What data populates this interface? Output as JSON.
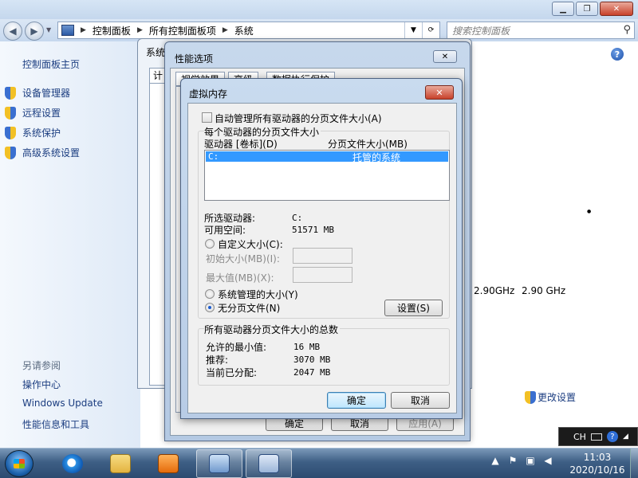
{
  "control_panel": {
    "breadcrumb": [
      "控制面板",
      "所有控制面板项",
      "系统"
    ],
    "search_placeholder": "搜索控制面板",
    "sidebar": {
      "home": "控制面板主页",
      "items": [
        "设备管理器",
        "远程设置",
        "系统保护",
        "高级系统设置"
      ],
      "see_also_title": "另请参阅",
      "see_also": [
        "操作中心",
        "Windows Update",
        "性能信息和工具"
      ]
    },
    "main": {
      "cpu_freq_1": "2.90GHz",
      "cpu_freq_2": "2.90 GHz",
      "change_settings": "更改设置"
    }
  },
  "system_properties": {
    "title": "系统",
    "tab_label": "计"
  },
  "performance_options": {
    "title": "性能选项",
    "tabs": [
      "视觉效果",
      "高级",
      "数据执行保护"
    ],
    "ok": "确定",
    "cancel": "取消",
    "apply": "应用(A)"
  },
  "virtual_memory": {
    "title": "虚拟内存",
    "auto_manage_label": "自动管理所有驱动器的分页文件大小(A)",
    "auto_manage_checked": false,
    "group_per_drive": "每个驱动器的分页文件大小",
    "col_drive": "驱动器 [卷标](D)",
    "col_size": "分页文件大小(MB)",
    "rows": [
      {
        "drive": "C:",
        "size": "托管的系统"
      }
    ],
    "selected_drive_label": "所选驱动器:",
    "selected_drive_value": "C:",
    "free_space_label": "可用空间:",
    "free_space_value": "51571 MB",
    "custom_size_label": "自定义大小(C):",
    "initial_size_label": "初始大小(MB)(I):",
    "max_size_label": "最大值(MB)(X):",
    "system_managed_label": "系统管理的大小(Y)",
    "no_paging_label": "无分页文件(N)",
    "selected_option": "no_paging",
    "set_button": "设置(S)",
    "group_total": "所有驱动器分页文件大小的总数",
    "min_allowed_label": "允许的最小值:",
    "min_allowed_value": "16 MB",
    "recommended_label": "推荐:",
    "recommended_value": "3070 MB",
    "allocated_label": "当前已分配:",
    "allocated_value": "2047 MB",
    "ok": "确定",
    "cancel": "取消"
  },
  "taskbar": {
    "lang": "CH",
    "time": "11:03",
    "date": "2020/10/16"
  }
}
